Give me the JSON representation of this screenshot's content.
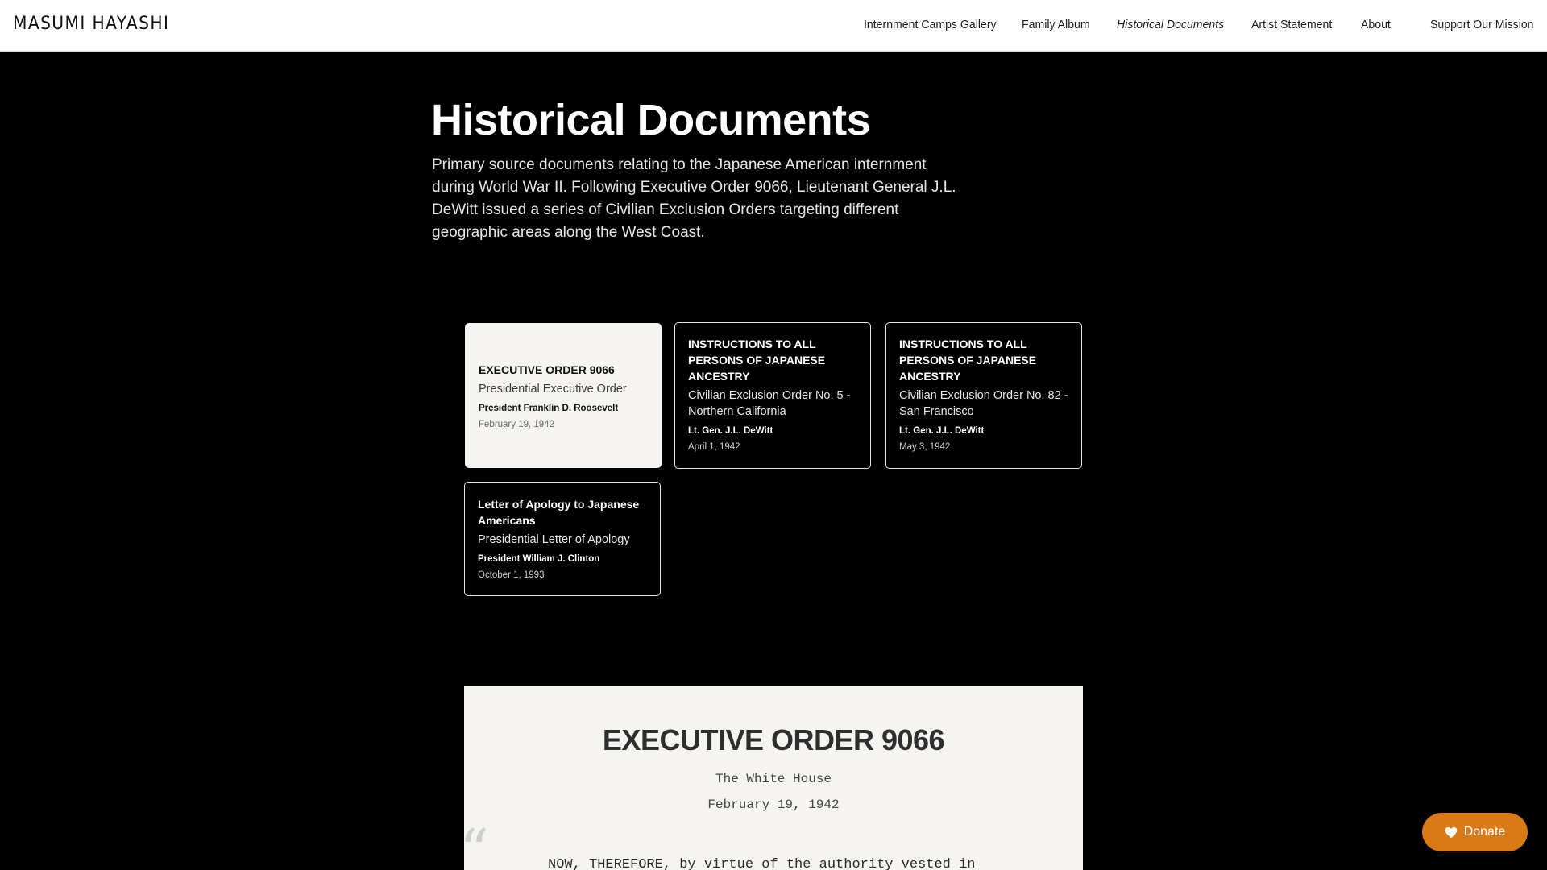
{
  "header": {
    "brand": "MASUMI HAYASHI",
    "nav": [
      {
        "label": "Internment Camps Gallery"
      },
      {
        "label": "Family Album"
      },
      {
        "label": "Historical Documents",
        "active": true
      },
      {
        "label": "Artist Statement"
      },
      {
        "label": "About"
      },
      {
        "label": "Support Our Mission"
      }
    ]
  },
  "hero": {
    "title": "Historical Documents",
    "intro": "Primary source documents relating to the Japanese American internment during World War II. Following Executive Order 9066, Lieutenant General J.L. DeWitt issued a series of Civilian Exclusion Orders targeting different geographic areas along the West Coast."
  },
  "documents": [
    {
      "title": "EXECUTIVE ORDER 9066",
      "subtitle": "Presidential Executive Order",
      "author": "President Franklin D. Roosevelt",
      "date": "February 19, 1942",
      "selected": true
    },
    {
      "title": "INSTRUCTIONS TO ALL PERSONS OF JAPANESE ANCESTRY",
      "subtitle": "Civilian Exclusion Order No. 5 - Northern California",
      "author": "Lt. Gen. J.L. DeWitt",
      "date": "April 1, 1942"
    },
    {
      "title": "INSTRUCTIONS TO ALL PERSONS OF JAPANESE ANCESTRY",
      "subtitle": "Civilian Exclusion Order No. 82 - San Francisco",
      "author": "Lt. Gen. J.L. DeWitt",
      "date": "May 3, 1942"
    },
    {
      "title": "Letter of Apology to Japanese Americans",
      "subtitle": "Presidential Letter of Apology",
      "author": "President William J. Clinton",
      "date": "October 1, 1993"
    }
  ],
  "viewer": {
    "title": "EXECUTIVE ORDER 9066",
    "place": "The White House",
    "date": "February 19, 1942",
    "quote_mark": "“",
    "body": "NOW, THEREFORE, by virtue of the authority vested in"
  },
  "donate": {
    "label": "Donate",
    "color": "#d97a16"
  },
  "colors": {
    "background": "#000000",
    "card_selected": "#f5f4f0",
    "accent": "#d97a16"
  }
}
